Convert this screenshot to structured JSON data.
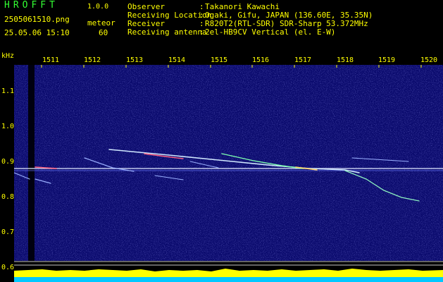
{
  "app": {
    "name": "HROFFT",
    "version": "1.0.0"
  },
  "file": {
    "name": "2505061510.png",
    "datetime": "25.05.06 15:10"
  },
  "meteor": {
    "label": "meteor",
    "count": "60"
  },
  "info": [
    {
      "label": "Observer",
      "value": "Takanori Kawachi"
    },
    {
      "label": "Receiving Location",
      "value": "Ogaki, Gifu, JAPAN (136.60E, 35.35N)"
    },
    {
      "label": "Receiver",
      "value": "R820T2(RTL-SDR) SDR-Sharp 53.372MHz"
    },
    {
      "label": "Receiving antenna",
      "value": "2el-HB9CV Vertical (el. E-W)"
    }
  ],
  "axis": {
    "y_unit": "kHz",
    "y_ticks": [
      "1.1",
      "1.0",
      "0.9",
      "0.8",
      "0.7",
      "0.6"
    ],
    "x_ticks": [
      "1511",
      "1512",
      "1513",
      "1514",
      "1515",
      "1516",
      "1517",
      "1518",
      "1519",
      "1520"
    ]
  },
  "colors": {
    "background": "#000000",
    "header_text": "#ffff00",
    "title_text": "#33ff33",
    "spectrogram_bg": "#0b0b6e",
    "signal_line": "#ffffff",
    "level_bar": "#ffff00",
    "level_base": "#00c8ff"
  }
}
